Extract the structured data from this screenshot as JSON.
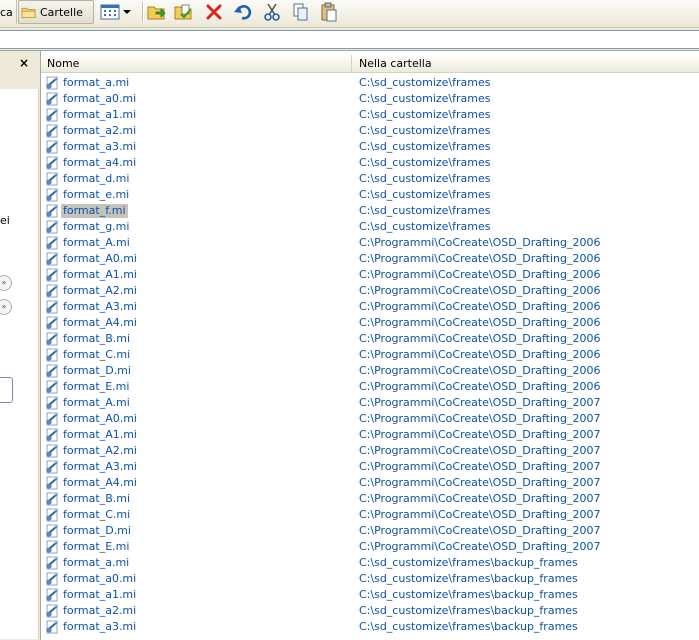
{
  "toolbar": {
    "search_fragment": "ca",
    "folders_label": "Cartelle"
  },
  "list": {
    "columns": {
      "name": "Nome",
      "folder": "Nella cartella"
    },
    "rows": [
      {
        "name": "format_a.mi",
        "folder": "C:\\sd_customize\\frames"
      },
      {
        "name": "format_a0.mi",
        "folder": "C:\\sd_customize\\frames"
      },
      {
        "name": "format_a1.mi",
        "folder": "C:\\sd_customize\\frames"
      },
      {
        "name": "format_a2.mi",
        "folder": "C:\\sd_customize\\frames"
      },
      {
        "name": "format_a3.mi",
        "folder": "C:\\sd_customize\\frames"
      },
      {
        "name": "format_a4.mi",
        "folder": "C:\\sd_customize\\frames"
      },
      {
        "name": "format_d.mi",
        "folder": "C:\\sd_customize\\frames"
      },
      {
        "name": "format_e.mi",
        "folder": "C:\\sd_customize\\frames"
      },
      {
        "name": "format_f.mi",
        "folder": "C:\\sd_customize\\frames",
        "selected": true
      },
      {
        "name": "format_g.mi",
        "folder": "C:\\sd_customize\\frames"
      },
      {
        "name": "format_A.mi",
        "folder": "C:\\Programmi\\CoCreate\\OSD_Drafting_2006"
      },
      {
        "name": "format_A0.mi",
        "folder": "C:\\Programmi\\CoCreate\\OSD_Drafting_2006"
      },
      {
        "name": "format_A1.mi",
        "folder": "C:\\Programmi\\CoCreate\\OSD_Drafting_2006"
      },
      {
        "name": "format_A2.mi",
        "folder": "C:\\Programmi\\CoCreate\\OSD_Drafting_2006"
      },
      {
        "name": "format_A3.mi",
        "folder": "C:\\Programmi\\CoCreate\\OSD_Drafting_2006"
      },
      {
        "name": "format_A4.mi",
        "folder": "C:\\Programmi\\CoCreate\\OSD_Drafting_2006"
      },
      {
        "name": "format_B.mi",
        "folder": "C:\\Programmi\\CoCreate\\OSD_Drafting_2006"
      },
      {
        "name": "format_C.mi",
        "folder": "C:\\Programmi\\CoCreate\\OSD_Drafting_2006"
      },
      {
        "name": "format_D.mi",
        "folder": "C:\\Programmi\\CoCreate\\OSD_Drafting_2006"
      },
      {
        "name": "format_E.mi",
        "folder": "C:\\Programmi\\CoCreate\\OSD_Drafting_2006"
      },
      {
        "name": "format_A.mi",
        "folder": "C:\\Programmi\\CoCreate\\OSD_Drafting_2007"
      },
      {
        "name": "format_A0.mi",
        "folder": "C:\\Programmi\\CoCreate\\OSD_Drafting_2007"
      },
      {
        "name": "format_A1.mi",
        "folder": "C:\\Programmi\\CoCreate\\OSD_Drafting_2007"
      },
      {
        "name": "format_A2.mi",
        "folder": "C:\\Programmi\\CoCreate\\OSD_Drafting_2007"
      },
      {
        "name": "format_A3.mi",
        "folder": "C:\\Programmi\\CoCreate\\OSD_Drafting_2007"
      },
      {
        "name": "format_A4.mi",
        "folder": "C:\\Programmi\\CoCreate\\OSD_Drafting_2007"
      },
      {
        "name": "format_B.mi",
        "folder": "C:\\Programmi\\CoCreate\\OSD_Drafting_2007"
      },
      {
        "name": "format_C.mi",
        "folder": "C:\\Programmi\\CoCreate\\OSD_Drafting_2007"
      },
      {
        "name": "format_D.mi",
        "folder": "C:\\Programmi\\CoCreate\\OSD_Drafting_2007"
      },
      {
        "name": "format_E.mi",
        "folder": "C:\\Programmi\\CoCreate\\OSD_Drafting_2007"
      },
      {
        "name": "format_a.mi",
        "folder": "C:\\sd_customize\\frames\\backup_frames"
      },
      {
        "name": "format_a0.mi",
        "folder": "C:\\sd_customize\\frames\\backup_frames"
      },
      {
        "name": "format_a1.mi",
        "folder": "C:\\sd_customize\\frames\\backup_frames"
      },
      {
        "name": "format_a2.mi",
        "folder": "C:\\sd_customize\\frames\\backup_frames"
      },
      {
        "name": "format_a3.mi",
        "folder": "C:\\sd_customize\\frames\\backup_frames"
      }
    ]
  },
  "left_pane": {
    "close_label": "×",
    "text_fragment": "ei"
  },
  "colors": {
    "link": "#0c52a8",
    "selection": "#c6c3bd",
    "chrome": "#ece9d8"
  }
}
